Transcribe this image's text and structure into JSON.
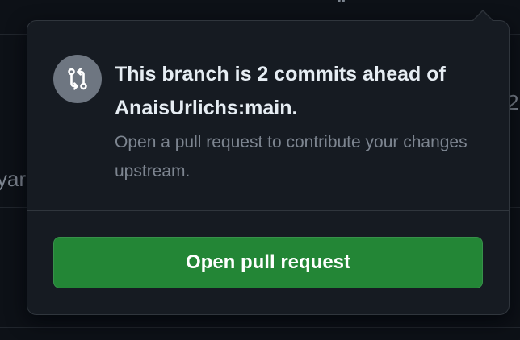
{
  "background": {
    "left_fragment": "yar",
    "right_fragment": "2"
  },
  "popover": {
    "icon": "git-compare-icon",
    "heading": "This branch is 2 commits ahead of AnaisUrlichs:main.",
    "description": "Open a pull request to contribute your changes upstream.",
    "button_label": "Open pull request"
  },
  "colors": {
    "background": "#0d1117",
    "popover_bg": "#161b22",
    "border": "#30363d",
    "button_green": "#238636",
    "icon_circle": "#6e7681",
    "heading_text": "#e6edf3",
    "muted_text": "#7d8590"
  }
}
